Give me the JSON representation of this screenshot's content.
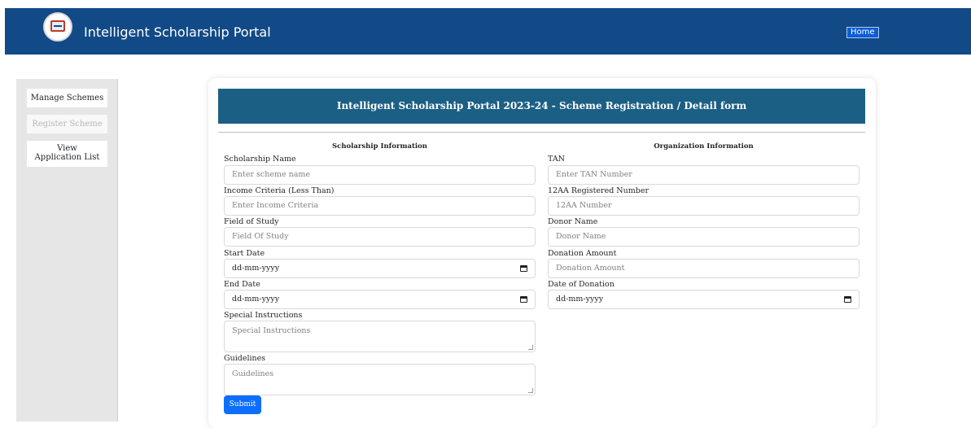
{
  "header": {
    "brand": "Intelligent Scholarship Portal",
    "home_label": "Home"
  },
  "sidebar": {
    "items": [
      {
        "label": "Manage Schemes"
      },
      {
        "label": "Register Scheme"
      },
      {
        "label": "View Application List"
      }
    ]
  },
  "form": {
    "title": "Intelligent Scholarship Portal 2023-24 - Scheme Registration / Detail form",
    "left_section": "Scholarship Information",
    "right_section": "Organization Information",
    "scholarship_name": {
      "label": "Scholarship Name",
      "placeholder": "Enter scheme name"
    },
    "income": {
      "label": "Income Criteria (Less Than)",
      "placeholder": "Enter Income Criteria"
    },
    "field_of_study": {
      "label": "Field of Study",
      "placeholder": "Field Of Study"
    },
    "start_date": {
      "label": "Start Date",
      "value": "dd-mm-yyyy"
    },
    "end_date": {
      "label": "End Date",
      "value": "dd-mm-yyyy"
    },
    "special_instructions": {
      "label": "Special Instructions",
      "placeholder": "Special Instructions"
    },
    "guidelines": {
      "label": "Guidelines",
      "placeholder": "Guidelines"
    },
    "tan": {
      "label": "TAN",
      "placeholder": "Enter TAN Number"
    },
    "reg_12aa": {
      "label": "12AA Registered Number",
      "placeholder": "12AA Number"
    },
    "donor_name": {
      "label": "Donor Name",
      "placeholder": "Donor Name"
    },
    "donation_amount": {
      "label": "Donation Amount",
      "placeholder": "Donation Amount"
    },
    "donation_date": {
      "label": "Date of Donation",
      "value": "dd-mm-yyyy"
    },
    "submit_label": "Submit"
  },
  "colors": {
    "topbar": "#124a87",
    "form_header": "#1c5f84",
    "primary_button": "#0d6efd"
  }
}
